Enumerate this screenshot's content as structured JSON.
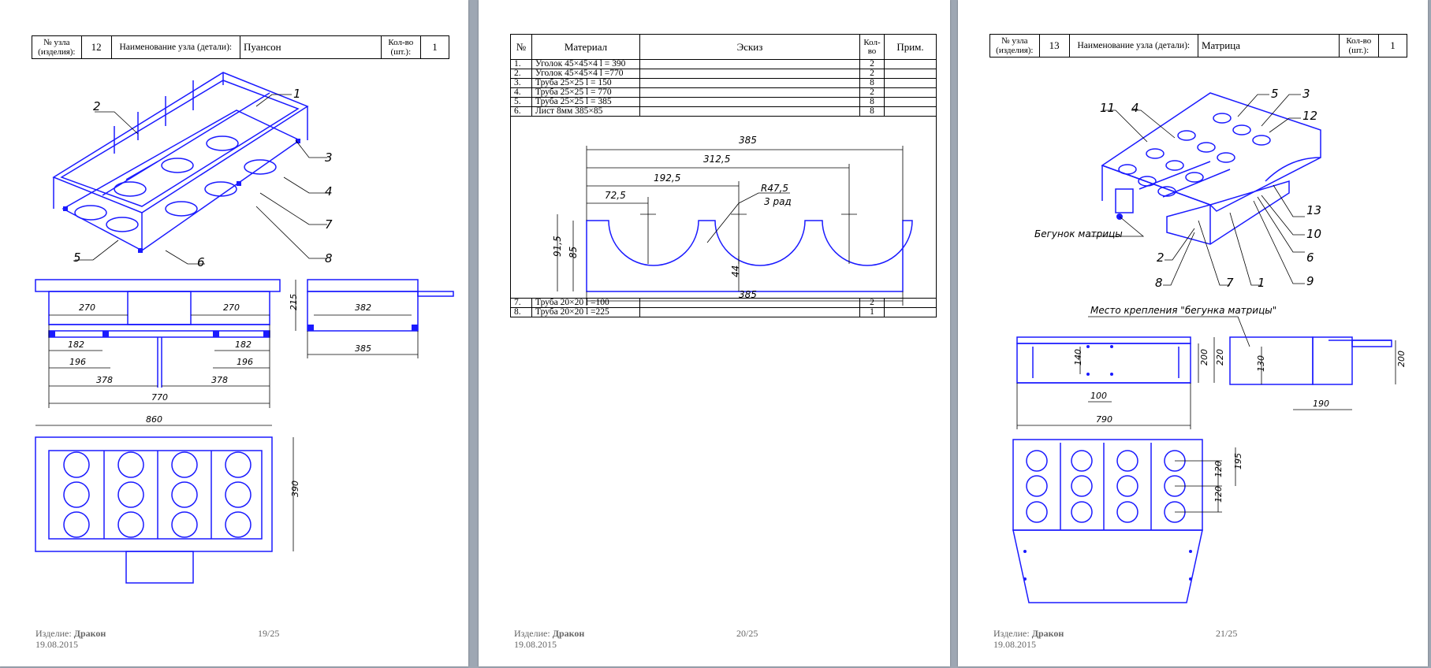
{
  "pages": [
    {
      "header": {
        "node_no_label": "№ узла (изделия):",
        "node_no": "12",
        "name_label": "Наименование узла (детали):",
        "name": "Пуансон",
        "qty_label": "Кол-во (шт.):",
        "qty": "1"
      },
      "callouts": [
        "1",
        "2",
        "3",
        "4",
        "5",
        "6",
        "7",
        "8"
      ],
      "dims": {
        "d270a": "270",
        "d270b": "270",
        "d215": "215",
        "d382": "382",
        "d385": "385",
        "d182a": "182",
        "d182b": "182",
        "d196a": "196",
        "d196b": "196",
        "d378a": "378",
        "d378b": "378",
        "d770": "770",
        "d860": "860",
        "d390": "390"
      },
      "footer": {
        "product_label": "Изделие:",
        "product": "Дракон",
        "date": "19.08.2015"
      },
      "page_no": "19/25"
    },
    {
      "table": {
        "headers": [
          "№",
          "Материал",
          "Эскиз",
          "Кол-во",
          "Прим."
        ],
        "rows": [
          {
            "n": "1.",
            "m": "Уголок 45×45×4  l = 390",
            "q": "2"
          },
          {
            "n": "2.",
            "m": "Уголок 45×45×4  l =770",
            "q": "2"
          },
          {
            "n": "3.",
            "m": "Труба 25×25  l = 150",
            "q": "8"
          },
          {
            "n": "4.",
            "m": "Труба 25×25  l = 770",
            "q": "2"
          },
          {
            "n": "5.",
            "m": "Труба 25×25  l = 385",
            "q": "8"
          },
          {
            "n": "6.",
            "m": "Лист 8мм  385×85",
            "q": "8"
          },
          {
            "n": "7.",
            "m": "Труба 20×20  l =100",
            "q": "2"
          },
          {
            "n": "8.",
            "m": "Труба 20×20  l =225",
            "q": "1"
          }
        ]
      },
      "sketch": {
        "d385top": "385",
        "d3125": "312,5",
        "d1925": "192,5",
        "d725": "72,5",
        "r": "R47,5",
        "r_note": "3 рад",
        "d915": "91,5",
        "d85": "85",
        "d44": "44",
        "d385bot": "385"
      },
      "footer": {
        "product_label": "Изделие:",
        "product": "Дракон",
        "date": "19.08.2015"
      },
      "page_no": "20/25"
    },
    {
      "header": {
        "node_no_label": "№ узла (изделия):",
        "node_no": "13",
        "name_label": "Наименование узла (детали):",
        "name": "Матрица",
        "qty_label": "Кол-во (шт.):",
        "qty": "1"
      },
      "callouts": [
        "11",
        "4",
        "5",
        "3",
        "12",
        "13",
        "10",
        "6",
        "9",
        "1",
        "7",
        "8",
        "2"
      ],
      "runner_label": "Бегунок матрицы",
      "mount_label": "Место крепления \"бегунка матрицы\"",
      "dims": {
        "d140": "140",
        "d200a": "200",
        "d220": "220",
        "d130": "130",
        "d200b": "200",
        "d100": "100",
        "d190": "190",
        "d790": "790",
        "d195": "195",
        "d120a": "120",
        "d120b": "120"
      },
      "footer": {
        "product_label": "Изделие:",
        "product": "Дракон",
        "date": "19.08.2015"
      },
      "page_no": "21/25"
    }
  ],
  "colors": {
    "drawing": "#1a1aff",
    "page": "#ffffff",
    "background": "#9ea7b3"
  }
}
